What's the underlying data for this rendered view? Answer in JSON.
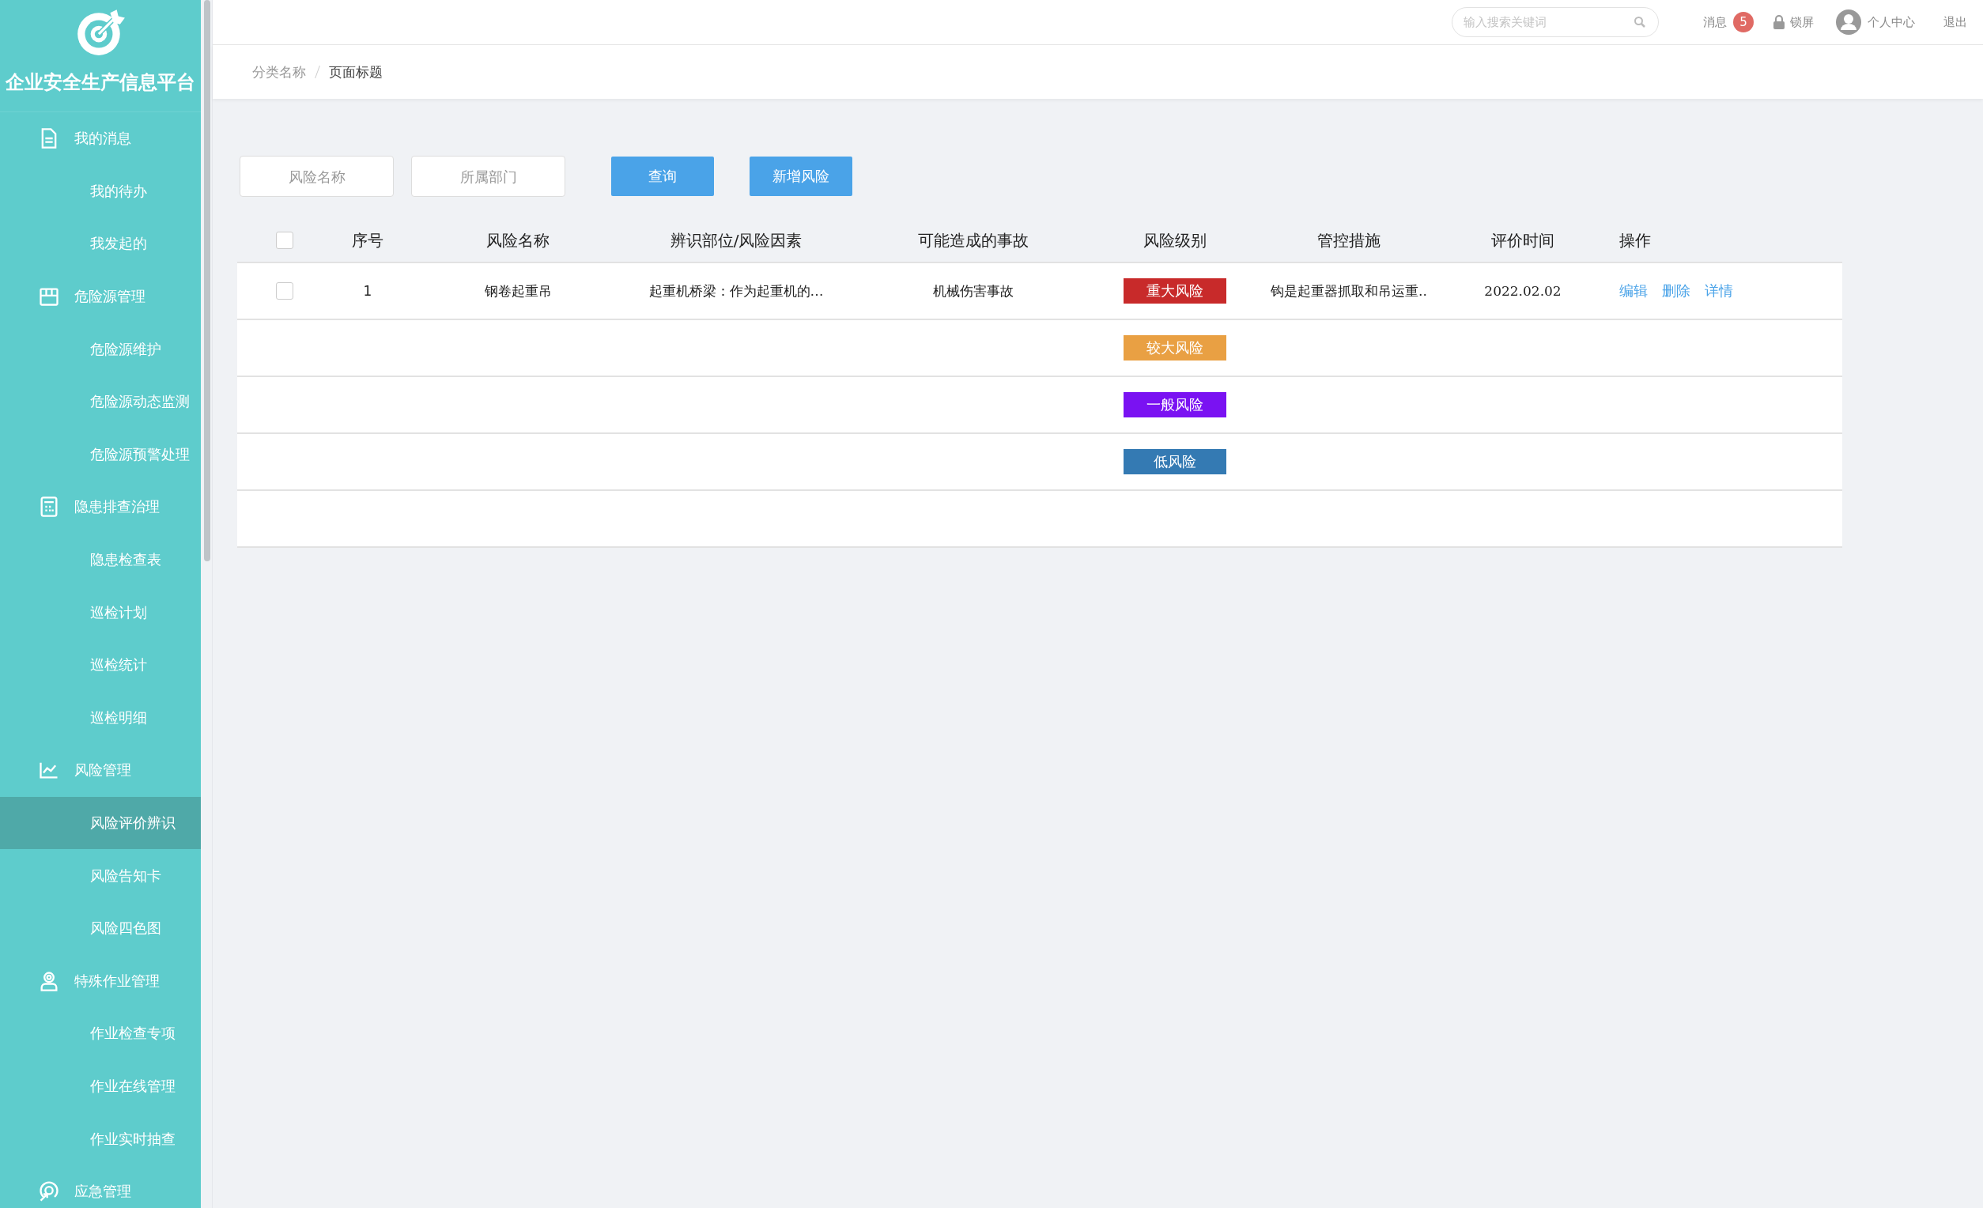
{
  "app": {
    "title": "企业安全生产信息平台"
  },
  "sidebar": {
    "items": [
      {
        "label": "我的消息",
        "children": [
          {
            "label": "我的待办",
            "selected": false
          },
          {
            "label": "我发起的",
            "selected": false
          }
        ]
      },
      {
        "label": "危险源管理",
        "children": [
          {
            "label": "危险源维护",
            "selected": false
          },
          {
            "label": "危险源动态监测",
            "selected": false
          },
          {
            "label": "危险源预警处理",
            "selected": false
          }
        ]
      },
      {
        "label": "隐患排查治理",
        "children": [
          {
            "label": "隐患检查表",
            "selected": false
          },
          {
            "label": "巡检计划",
            "selected": false
          },
          {
            "label": "巡检统计",
            "selected": false
          },
          {
            "label": "巡检明细",
            "selected": false
          }
        ]
      },
      {
        "label": "风险管理",
        "children": [
          {
            "label": "风险评价辨识",
            "selected": true
          },
          {
            "label": "风险告知卡",
            "selected": false
          },
          {
            "label": "风险四色图",
            "selected": false
          }
        ]
      },
      {
        "label": "特殊作业管理",
        "children": [
          {
            "label": "作业检查专项",
            "selected": false
          },
          {
            "label": "作业在线管理",
            "selected": false
          },
          {
            "label": "作业实时抽查",
            "selected": false
          }
        ]
      },
      {
        "label": "应急管理"
      }
    ]
  },
  "top_bar": {
    "search": {
      "placeholder": "输入搜索关键词"
    },
    "messages": {
      "label": "消息",
      "badge": "5"
    },
    "lock": "锁屏",
    "profile": "个人中心",
    "logout": "退出"
  },
  "breadcrumb": [
    "分类名称",
    "页面标题"
  ],
  "filters": [
    {
      "placeholder": "风险名称"
    },
    {
      "placeholder": "所属部门"
    }
  ],
  "buttons": [
    "查询",
    "新增风险"
  ],
  "table": {
    "header_checked": false,
    "columns": [
      "序号",
      "风险名称",
      "辨识部位/风险因素",
      "可能造成的事故",
      "风险级别",
      "管控措施",
      "评价时间",
      "操作"
    ],
    "rows": [
      {
        "checked": false,
        "index": "1",
        "name": "钢卷起重吊",
        "factor": "起重机桥梁：作为起重机的…",
        "accident": "机械伤害事故",
        "level": {
          "label": "重大风险",
          "color": "#c82a2a"
        },
        "measure": "钩是起重器抓取和吊运重..",
        "date": "2022.02.02",
        "actions": [
          "编辑",
          "删除",
          "详情"
        ]
      },
      {
        "level": {
          "label": "较大风险",
          "color": "#e9a043"
        }
      },
      {
        "level": {
          "label": "一般风险",
          "color": "#7a12f2"
        }
      },
      {
        "level": {
          "label": "低风险",
          "color": "#347ab3"
        }
      },
      {}
    ]
  }
}
